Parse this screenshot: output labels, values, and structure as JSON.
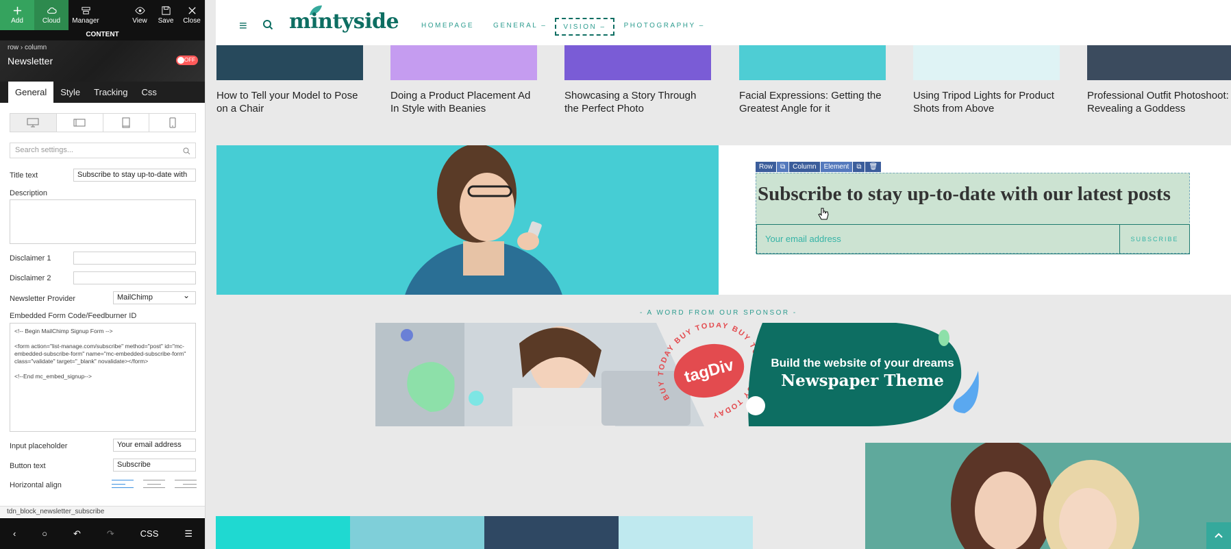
{
  "toolbar": {
    "add": "Add",
    "cloud": "Cloud",
    "manager": "Manager",
    "view": "View",
    "save": "Save",
    "close": "Close",
    "content_label": "CONTENT"
  },
  "element": {
    "breadcrumb": "row › column",
    "title": "Newsletter",
    "toggle": "OFF"
  },
  "tabs": [
    "General",
    "Style",
    "Tracking",
    "Css"
  ],
  "settings": {
    "search_placeholder": "Search settings...",
    "title_text_label": "Title text",
    "title_text_value": "Subscribe to stay up-to-date with",
    "description_label": "Description",
    "disclaimer1_label": "Disclaimer 1",
    "disclaimer2_label": "Disclaimer 2",
    "provider_label": "Newsletter Provider",
    "provider_value": "MailChimp",
    "embed_label": "Embedded Form Code/Feedburner ID",
    "embed_code": "<!-- Begin MailChimp Signup Form -->\n\n<form action=\"list-manage.com/subscribe\" method=\"post\" id=\"mc-embedded-subscribe-form\" name=\"mc-embedded-subscribe-form\" class=\"validate\" target=\"_blank\" novalidate></form>\n\n<!--End mc_embed_signup-->",
    "input_placeholder_label": "Input placeholder",
    "input_placeholder_value": "Your email address",
    "button_text_label": "Button text",
    "button_text_value": "Subscribe",
    "horizontal_align_label": "Horizontal align"
  },
  "status": {
    "block_name": "tdn_block_newsletter_subscribe"
  },
  "bottombar": {
    "css": "CSS"
  },
  "site": {
    "logo": "mintyside",
    "nav": [
      "HOMEPAGE",
      "GENERAL –",
      "VISION –",
      "PHOTOGRAPHY –"
    ],
    "posts": [
      {
        "title": "How to Tell your Model to Pose on a Chair",
        "color": "#27495c"
      },
      {
        "title": "Doing a Product Placement Ad In Style with Beanies",
        "color": "#c59cf0"
      },
      {
        "title": "Showcasing a Story Through the Perfect Photo",
        "color": "#7a5cd6"
      },
      {
        "title": "Facial Expressions: Getting the Greatest Angle for it",
        "color": "#4ecdd4"
      },
      {
        "title": "Using Tripod Lights for Product Shots from Above",
        "color": "#dff3f5"
      },
      {
        "title": "Professional Outfit Photoshoot: Revealing a Goddess",
        "color": "#3b4b5e"
      }
    ],
    "newsletter": {
      "element_toolbar": [
        "Row",
        "Column",
        "Element"
      ],
      "title": "Subscribe to stay up-to-date with our latest posts",
      "placeholder": "Your email address",
      "button": "SUBSCRIBE"
    },
    "sponsor_label": "- A WORD FROM OUR SPONSOR -",
    "banner": {
      "badge": "tagDiv",
      "ring_text": "BUY TODAY BUY TODAY BUY TODAY BUY TODAY",
      "line1": "Build the website of your dreams",
      "line2": "Newspaper Theme"
    },
    "colors": {
      "accent": "#0d6e62",
      "teal": "#46cdd4",
      "badge_red": "#e34b4f"
    }
  }
}
